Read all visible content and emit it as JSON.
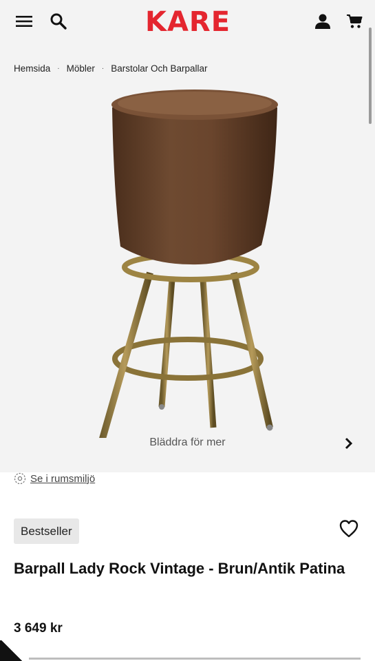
{
  "header": {
    "logo_text": "KARE",
    "icons": [
      "hamburger-menu-icon",
      "search-icon",
      "user-icon",
      "cart-icon"
    ]
  },
  "breadcrumb": {
    "items": [
      "Hemsida",
      "Möbler",
      "Barstolar Och Barpallar"
    ],
    "separator": "·"
  },
  "gallery": {
    "browse_hint": "Bläddra för mer"
  },
  "room_link": {
    "label": "Se i rumsmiljö"
  },
  "product": {
    "badge": "Bestseller",
    "title": "Barpall Lady Rock Vintage - Brun/Antik Patina",
    "price": "3 649 kr"
  },
  "colors": {
    "brand": "#e4262f",
    "gallery_bg": "#f3f3f3",
    "badge_bg": "#e8e8e8"
  }
}
